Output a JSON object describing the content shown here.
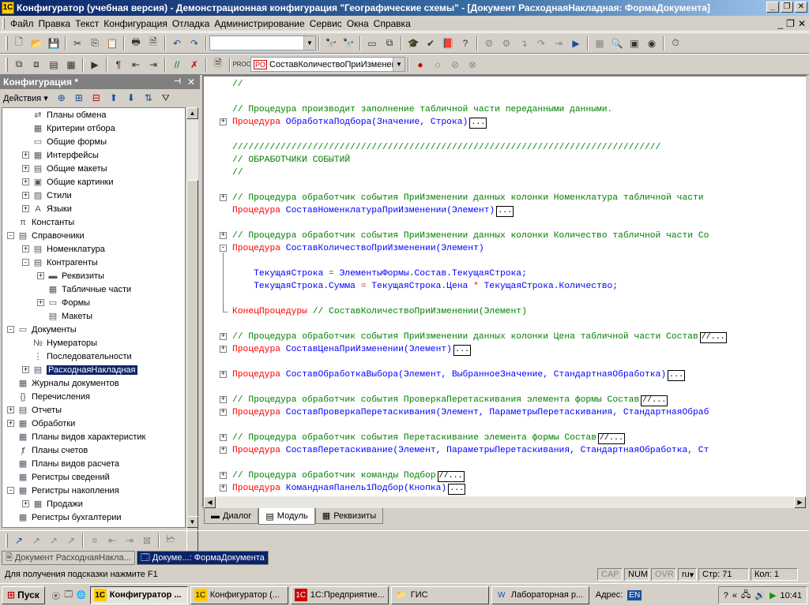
{
  "window": {
    "title": "Конфигуратор (учебная версия) - Демонстрационная конфигурация \"Географические схемы\" - [Документ РасходнаяНакладная: ФормаДокумента]"
  },
  "menu": [
    "Файл",
    "Правка",
    "Текст",
    "Конфигурация",
    "Отладка",
    "Администрирование",
    "Сервис",
    "Окна",
    "Справка"
  ],
  "toolbar2": {
    "combo_value": "СоставКоличествоПриИзменени"
  },
  "panel": {
    "title": "Конфигурация *",
    "actions_label": "Действия",
    "tree": [
      {
        "label": "Планы обмена",
        "indent": 2,
        "exp": ""
      },
      {
        "label": "Критерии отбора",
        "indent": 2,
        "exp": ""
      },
      {
        "label": "Общие формы",
        "indent": 2,
        "exp": ""
      },
      {
        "label": "Интерфейсы",
        "indent": 2,
        "exp": "+"
      },
      {
        "label": "Общие макеты",
        "indent": 2,
        "exp": "+"
      },
      {
        "label": "Общие картинки",
        "indent": 2,
        "exp": "+"
      },
      {
        "label": "Стили",
        "indent": 2,
        "exp": "+"
      },
      {
        "label": "Языки",
        "indent": 2,
        "exp": "+"
      },
      {
        "label": "Константы",
        "indent": 1,
        "exp": ""
      },
      {
        "label": "Справочники",
        "indent": 1,
        "exp": "-"
      },
      {
        "label": "Номенклатура",
        "indent": 2,
        "exp": "+"
      },
      {
        "label": "Контрагенты",
        "indent": 2,
        "exp": "-"
      },
      {
        "label": "Реквизиты",
        "indent": 3,
        "exp": "+"
      },
      {
        "label": "Табличные части",
        "indent": 3,
        "exp": ""
      },
      {
        "label": "Формы",
        "indent": 3,
        "exp": "+"
      },
      {
        "label": "Макеты",
        "indent": 3,
        "exp": ""
      },
      {
        "label": "Документы",
        "indent": 1,
        "exp": "-"
      },
      {
        "label": "Нумераторы",
        "indent": 2,
        "exp": ""
      },
      {
        "label": "Последовательности",
        "indent": 2,
        "exp": ""
      },
      {
        "label": "РасходнаяНакладная",
        "indent": 2,
        "exp": "+",
        "selected": true
      },
      {
        "label": "Журналы документов",
        "indent": 1,
        "exp": ""
      },
      {
        "label": "Перечисления",
        "indent": 1,
        "exp": ""
      },
      {
        "label": "Отчеты",
        "indent": 1,
        "exp": "+"
      },
      {
        "label": "Обработки",
        "indent": 1,
        "exp": "+"
      },
      {
        "label": "Планы видов характеристик",
        "indent": 1,
        "exp": ""
      },
      {
        "label": "Планы счетов",
        "indent": 1,
        "exp": ""
      },
      {
        "label": "Планы видов расчета",
        "indent": 1,
        "exp": ""
      },
      {
        "label": "Регистры сведений",
        "indent": 1,
        "exp": ""
      },
      {
        "label": "Регистры накопления",
        "indent": 1,
        "exp": "-"
      },
      {
        "label": "Продажи",
        "indent": 2,
        "exp": "+"
      },
      {
        "label": "Регистры бухгалтерии",
        "indent": 1,
        "exp": ""
      }
    ]
  },
  "code": [
    {
      "t": "comment",
      "text": "//"
    },
    {
      "t": "blank"
    },
    {
      "t": "comment",
      "text": "// Процедура производит заполнение табличной части переданными данными."
    },
    {
      "t": "proc",
      "mark": "+",
      "kw": "Процедура",
      "name": "ОбработкаПодбора",
      "args": "(Значение, Строка)",
      "dots": "..."
    },
    {
      "t": "blank"
    },
    {
      "t": "comment",
      "text": "////////////////////////////////////////////////////////////////////////////////"
    },
    {
      "t": "comment",
      "text": "// ОБРАБОТЧИКИ СОБЫТИЙ"
    },
    {
      "t": "comment",
      "text": "//"
    },
    {
      "t": "blank"
    },
    {
      "t": "comment",
      "mark": "+",
      "text": "// Процедура обработчик события ПриИзменении данных колонки Номенклатура табличной части"
    },
    {
      "t": "proc",
      "kw": "Процедура",
      "name": "СоставНоменклатураПриИзменении",
      "args": "(Элемент)",
      "dots": "..."
    },
    {
      "t": "blank"
    },
    {
      "t": "comment",
      "mark": "+",
      "text": "// Процедура обработчик события ПриИзменении данных колонки Количество табличной части Со"
    },
    {
      "t": "proc",
      "mark": "-",
      "kw": "Процедура",
      "name": "СоставКоличествоПриИзменении",
      "args": "(Элемент)"
    },
    {
      "t": "blank"
    },
    {
      "t": "code",
      "text": "    ТекущаяСтрока = ЭлементыФормы.Состав.ТекущаяСтрока;"
    },
    {
      "t": "code",
      "text": "    ТекущаяСтрока.Сумма = ТекущаяСтрока.Цена * ТекущаяСтрока.Количество;"
    },
    {
      "t": "blank"
    },
    {
      "t": "end",
      "kw": "КонецПроцедуры",
      "comment": " // СоставКоличествоПриИзменении(Элемент)"
    },
    {
      "t": "blank"
    },
    {
      "t": "comment",
      "mark": "+",
      "text": "// Процедура обработчик события ПриИзменении данных колонки Цена табличной части Состав",
      "dots": "//..."
    },
    {
      "t": "proc",
      "mark": "+",
      "kw": "Процедура",
      "name": "СоставЦенаПриИзменении",
      "args": "(Элемент)",
      "dots": "..."
    },
    {
      "t": "blank"
    },
    {
      "t": "proc",
      "mark": "+",
      "kw": "Процедура",
      "name": "СоставОбработкаВыбора",
      "args": "(Элемент, ВыбранноеЗначение, СтандартнаяОбработка)",
      "dots": "..."
    },
    {
      "t": "blank"
    },
    {
      "t": "comment",
      "mark": "+",
      "text": "// Процедура обработчик события ПроверкаПеретаскивания элемента формы Состав",
      "dots": "//..."
    },
    {
      "t": "proc",
      "mark": "+",
      "kw": "Процедура",
      "name": "СоставПроверкаПеретаскивания",
      "args": "(Элемент, ПараметрыПеретаскивания, СтандартнаяОбраб"
    },
    {
      "t": "blank"
    },
    {
      "t": "comment",
      "mark": "+",
      "text": "// Процедура обработчик события Перетаскивание элемента формы Состав",
      "dots": "//..."
    },
    {
      "t": "proc",
      "mark": "+",
      "kw": "Процедура",
      "name": "СоставПеретаскивание",
      "args": "(Элемент, ПараметрыПеретаскивания, СтандартнаяОбработка, Ст"
    },
    {
      "t": "blank"
    },
    {
      "t": "comment",
      "mark": "+",
      "text": "// Процедура обработчик команды Подбор",
      "dots": "//..."
    },
    {
      "t": "proc",
      "mark": "+",
      "kw": "Процедура",
      "name": "КоманднаяПанель1Подбор",
      "args": "(Кнопка)",
      "dots": "..."
    }
  ],
  "tabs": [
    "Диалог",
    "Модуль",
    "Реквизиты"
  ],
  "active_tab": "Модуль",
  "window_tabs": [
    "Документ РасходнаяНакла...",
    "Докуме...: ФормаДокумента"
  ],
  "status": {
    "hint": "Для получения подсказки нажмите F1",
    "cap": "CAP",
    "num": "NUM",
    "ovr": "OVR",
    "lang": "ru",
    "row": "Стр: 71",
    "col": "Кол: 1"
  },
  "taskbar": {
    "start": "Пуск",
    "tasks": [
      "Конфигуратор ...",
      "Конфигуратор (...",
      "1С:Предприятие...",
      "ГИС",
      "Лабораторная р..."
    ],
    "address_label": "Адрес:",
    "lang": "EN",
    "clock": "10:41"
  }
}
